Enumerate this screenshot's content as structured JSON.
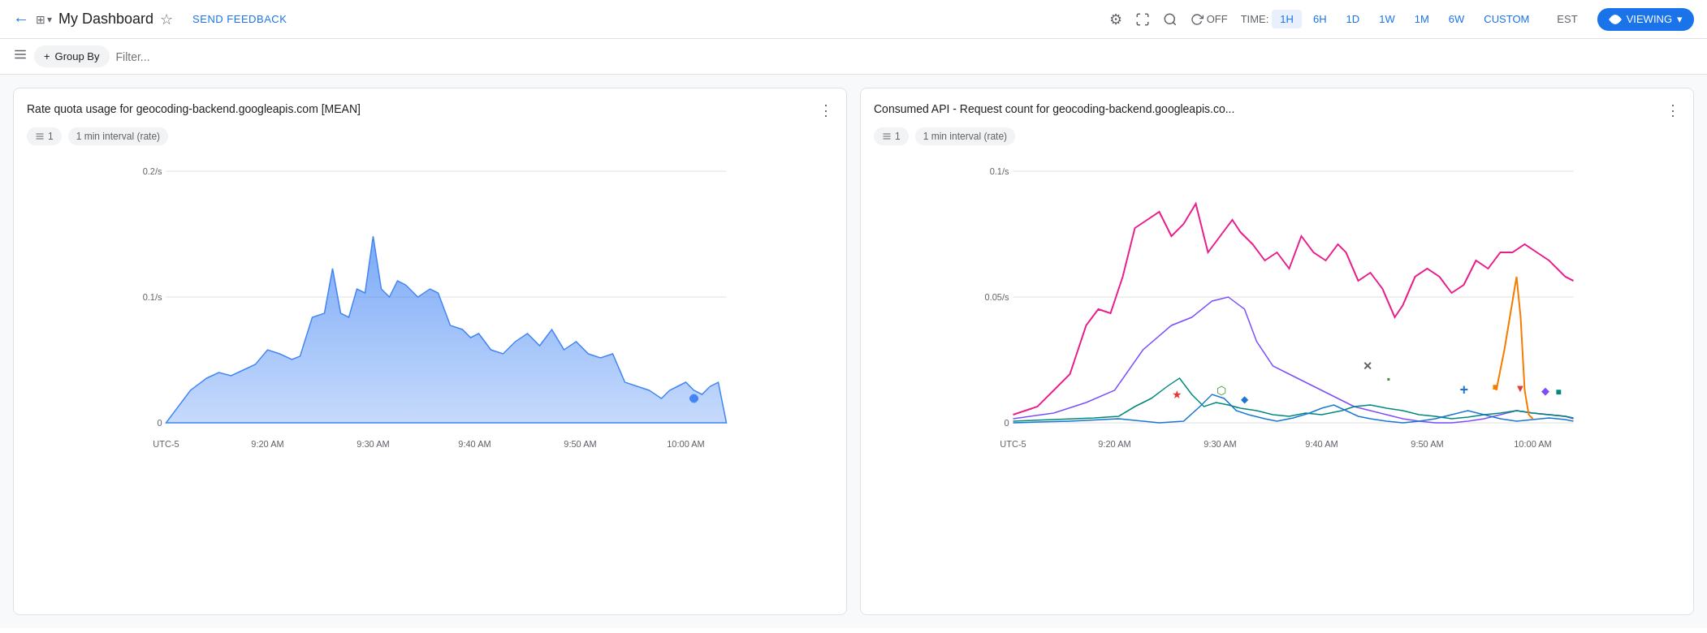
{
  "header": {
    "back_label": "←",
    "dashboard_icon": "⊞",
    "dashboard_icon_dropdown": "▾",
    "title": "My Dashboard",
    "star_icon": "☆",
    "send_feedback": "SEND FEEDBACK",
    "settings_icon": "⚙",
    "fullscreen_icon": "⛶",
    "search_icon": "🔍",
    "refresh_icon": "↻",
    "refresh_label": "OFF",
    "time_label": "TIME:",
    "time_buttons": [
      "1H",
      "6H",
      "1D",
      "1W",
      "1M",
      "6W",
      "CUSTOM"
    ],
    "active_time": "1H",
    "timezone": "EST",
    "viewing_icon": "👁",
    "viewing_label": "VIEWING",
    "viewing_dropdown": "▾"
  },
  "toolbar": {
    "filter_icon": "≡",
    "group_by_icon": "+",
    "group_by_label": "Group By",
    "filter_placeholder": "Filter..."
  },
  "charts": [
    {
      "id": "chart1",
      "title": "Rate quota usage for geocoding-backend.googleapis.com [MEAN]",
      "more_icon": "⋮",
      "filter_count": "1",
      "interval_label": "1 min interval (rate)",
      "y_max_label": "0.2/s",
      "y_mid_label": "0.1/s",
      "y_min_label": "0",
      "x_labels": [
        "UTC-5",
        "9:20 AM",
        "9:30 AM",
        "9:40 AM",
        "9:50 AM",
        "10:00 AM"
      ],
      "type": "area",
      "color": "#4285f4"
    },
    {
      "id": "chart2",
      "title": "Consumed API - Request count for geocoding-backend.googleapis.co...",
      "more_icon": "⋮",
      "filter_count": "1",
      "interval_label": "1 min interval (rate)",
      "y_max_label": "0.1/s",
      "y_mid_label": "0.05/s",
      "y_min_label": "0",
      "x_labels": [
        "UTC-5",
        "9:20 AM",
        "9:30 AM",
        "9:40 AM",
        "9:50 AM",
        "10:00 AM"
      ],
      "type": "multiline"
    }
  ]
}
